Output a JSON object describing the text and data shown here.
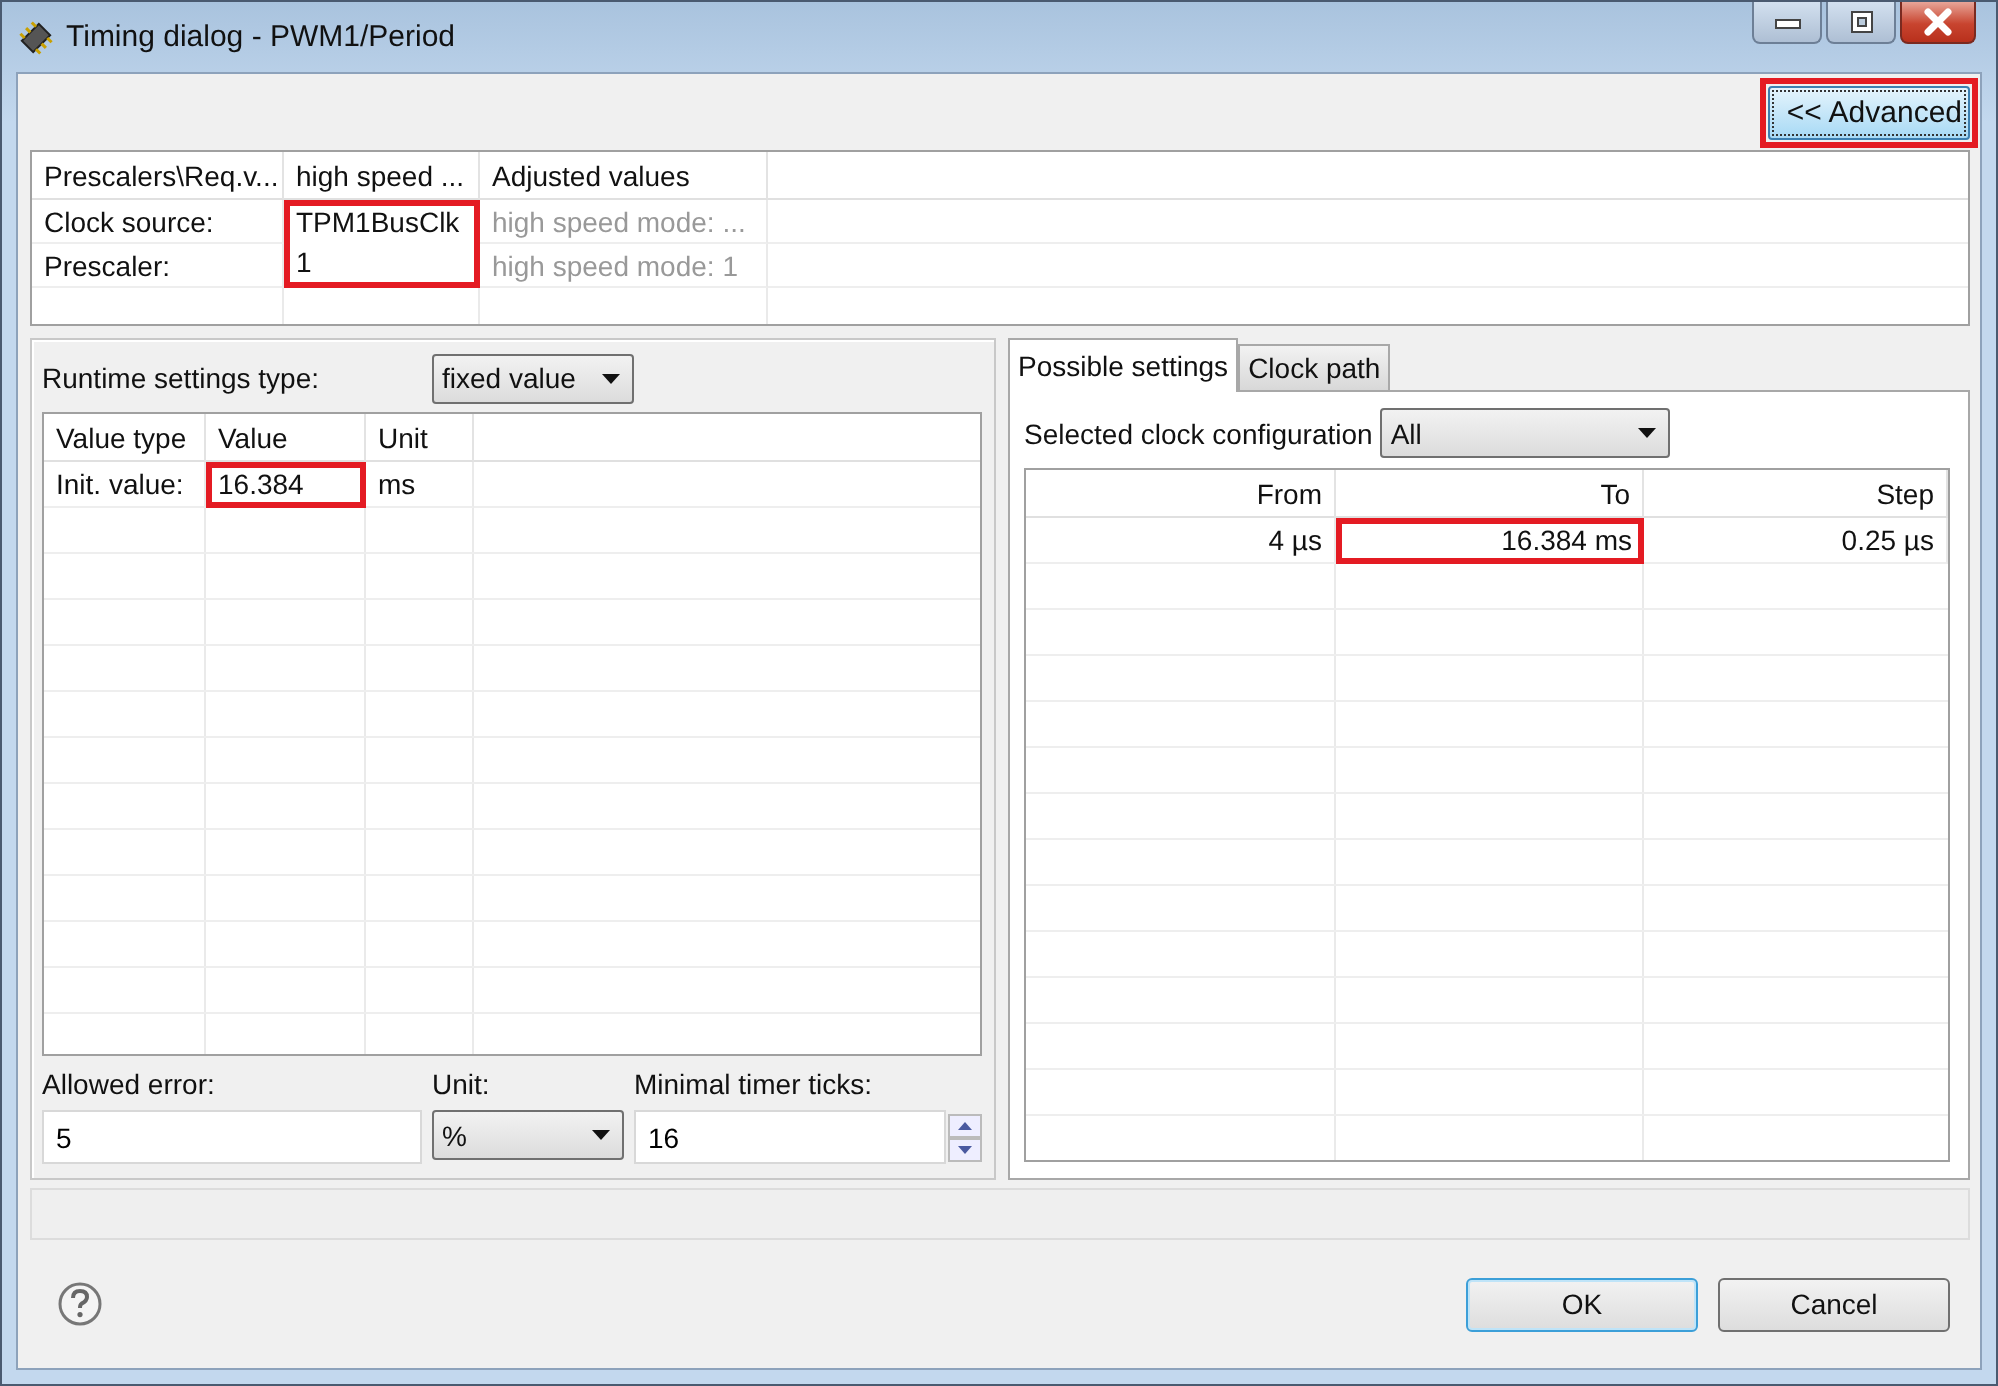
{
  "window": {
    "title": "Timing dialog - PWM1/Period"
  },
  "advanced_button": {
    "label": "<< Advanced",
    "highlighted": true
  },
  "prescaler_table": {
    "columns": [
      "Prescalers\\Req.v...",
      "high speed ...",
      "Adjusted values"
    ],
    "rows": [
      {
        "label": "Clock source:",
        "value": "TPM1BusClk",
        "value_highlighted": true,
        "adjusted": "high speed mode: ...",
        "adjusted_disabled": true
      },
      {
        "label": "Prescaler:",
        "value": "1",
        "value_highlighted": true,
        "adjusted": "high speed mode: 1",
        "adjusted_disabled": true
      }
    ]
  },
  "runtime_settings": {
    "label": "Runtime settings type:",
    "value": "fixed value"
  },
  "value_table": {
    "columns": [
      "Value type",
      "Value",
      "Unit"
    ],
    "rows": [
      {
        "value_type": "Init. value:",
        "value": "16.384",
        "value_highlighted": true,
        "unit": "ms"
      }
    ]
  },
  "allowed_error": {
    "label": "Allowed error:",
    "value": "5"
  },
  "unit": {
    "label": "Unit:",
    "value": "%"
  },
  "minimal_timer_ticks": {
    "label": "Minimal timer ticks:",
    "value": "16"
  },
  "tabs": [
    {
      "label": "Possible settings",
      "selected": true
    },
    {
      "label": "Clock path",
      "selected": false
    }
  ],
  "clock_configuration": {
    "label": "Selected clock configuration",
    "value": "All"
  },
  "ranges_table": {
    "columns": [
      "From",
      "To",
      "Step"
    ],
    "rows": [
      {
        "from": "4 µs",
        "to": "16.384 ms",
        "to_highlighted": true,
        "step": "0.25 µs"
      }
    ]
  },
  "buttons": [
    {
      "label": "OK",
      "default": true
    },
    {
      "label": "Cancel",
      "default": false
    }
  ]
}
